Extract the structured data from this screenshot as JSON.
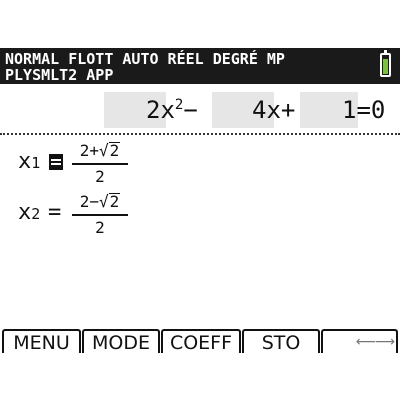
{
  "status": {
    "line1": "NORMAL FLOTT AUTO RÉEL DEGRÉ MP",
    "line2": "PLYSMLT2 APP",
    "battery_color": "#7cc142",
    "battery_level": 0.85
  },
  "equation": {
    "term1": "2x",
    "exp1": "2",
    "op1": "−",
    "term2": "4x+",
    "term3": "1",
    "rhs": "=0"
  },
  "solutions": [
    {
      "var": "x",
      "sub": "1",
      "num_a": "2+",
      "num_rad": "2",
      "den": "2"
    },
    {
      "var": "x",
      "sub": "2",
      "eq": "=",
      "num_a": "2−",
      "num_rad": "2",
      "den": "2"
    }
  ],
  "menu": {
    "items": [
      "MENU",
      "MODE",
      "COEFF",
      "STO",
      ""
    ],
    "arrows_icon": "left-right-arrows-icon"
  }
}
